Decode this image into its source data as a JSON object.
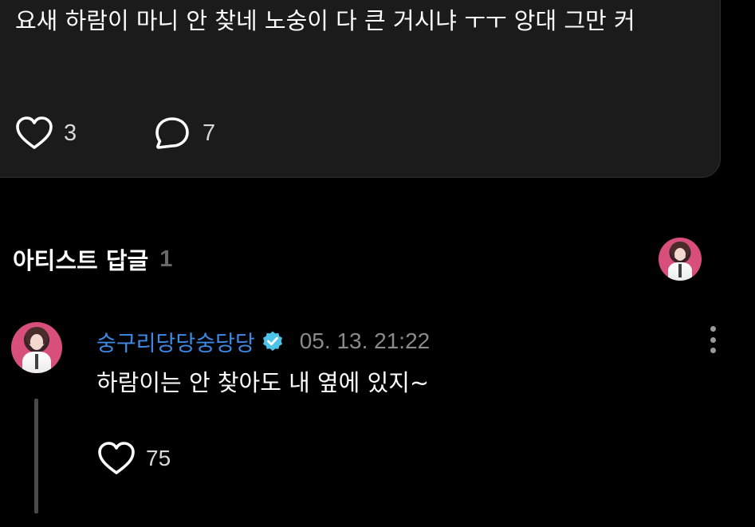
{
  "post": {
    "text": "요새 하람이 마니 안 찾네 노숭이 다 큰 거시냐 ㅜㅜ 앙대 그만 커",
    "like_count": "3",
    "comment_count": "7"
  },
  "artist_replies": {
    "title": "아티스트 답글",
    "count": "1"
  },
  "reply": {
    "author": "숭구리당당숭당당",
    "timestamp": "05. 13. 21:22",
    "text": "하람이는 안 찾아도 내 옆에 있지~",
    "like_count": "75"
  },
  "colors": {
    "background": "#000000",
    "card": "#1b1b1b",
    "author_accent": "#3d8ae6",
    "verified_badge": "#4cc3e8",
    "muted_text": "#8a8a8a"
  },
  "icons": {
    "like": "heart-outline-icon",
    "comment": "speech-bubble-icon",
    "verified": "verified-badge-icon",
    "more": "more-vertical-icon"
  }
}
